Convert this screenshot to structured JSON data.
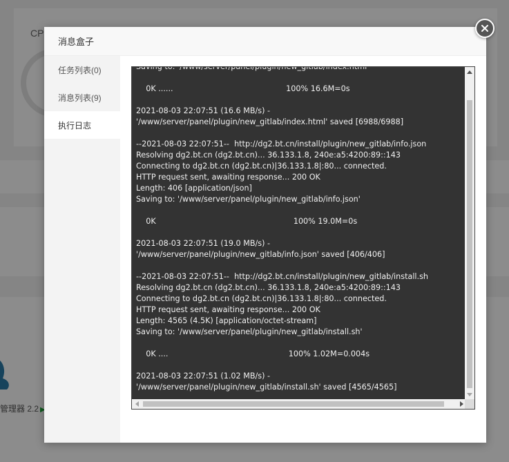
{
  "background": {
    "cpu_label": "CP",
    "app_label": "管理器 2.2",
    "play_glyph": "▶"
  },
  "modal": {
    "title": "消息盒子",
    "sidebar": [
      {
        "label": "任务列表(0)"
      },
      {
        "label": "消息列表(9)"
      },
      {
        "label": "执行日志"
      }
    ],
    "active_tab": "执行日志",
    "log_lines": [
      "Saving to: '/www/server/panel/plugin/new_gitlab/index.html'",
      "",
      "    0K ......                                              100% 16.6M=0s",
      "",
      "2021-08-03 22:07:51 (16.6 MB/s) -",
      "'/www/server/panel/plugin/new_gitlab/index.html' saved [6988/6988]",
      "",
      "--2021-08-03 22:07:51--  http://dg2.bt.cn/install/plugin/new_gitlab/info.json",
      "Resolving dg2.bt.cn (dg2.bt.cn)... 36.133.1.8, 240e:a5:4200:89::143",
      "Connecting to dg2.bt.cn (dg2.bt.cn)|36.133.1.8|:80... connected.",
      "HTTP request sent, awaiting response... 200 OK",
      "Length: 406 [application/json]",
      "Saving to: '/www/server/panel/plugin/new_gitlab/info.json'",
      "",
      "    0K                                                        100% 19.0M=0s",
      "",
      "2021-08-03 22:07:51 (19.0 MB/s) -",
      "'/www/server/panel/plugin/new_gitlab/info.json' saved [406/406]",
      "",
      "--2021-08-03 22:07:51--  http://dg2.bt.cn/install/plugin/new_gitlab/install.sh",
      "Resolving dg2.bt.cn (dg2.bt.cn)... 36.133.1.8, 240e:a5:4200:89::143",
      "Connecting to dg2.bt.cn (dg2.bt.cn)|36.133.1.8|:80... connected.",
      "HTTP request sent, awaiting response... 200 OK",
      "Length: 4565 (4.5K) [application/octet-stream]",
      "Saving to: '/www/server/panel/plugin/new_gitlab/install.sh'",
      "",
      "    0K ....                                                 100% 1.02M=0.004s",
      "",
      "2021-08-03 22:07:51 (1.02 MB/s) -",
      "'/www/server/panel/plugin/new_gitlab/install.sh' saved [4565/4565]"
    ]
  },
  "colors": {
    "terminal_bg": "#333333",
    "terminal_text": "#f0f0f0",
    "close_button": "#555555",
    "accent_green": "#20a53a"
  },
  "icons": {
    "close": "close-icon",
    "scroll_up": "chevron-up-icon",
    "scroll_down": "chevron-down-icon",
    "scroll_left": "chevron-left-icon",
    "scroll_right": "chevron-right-icon"
  }
}
